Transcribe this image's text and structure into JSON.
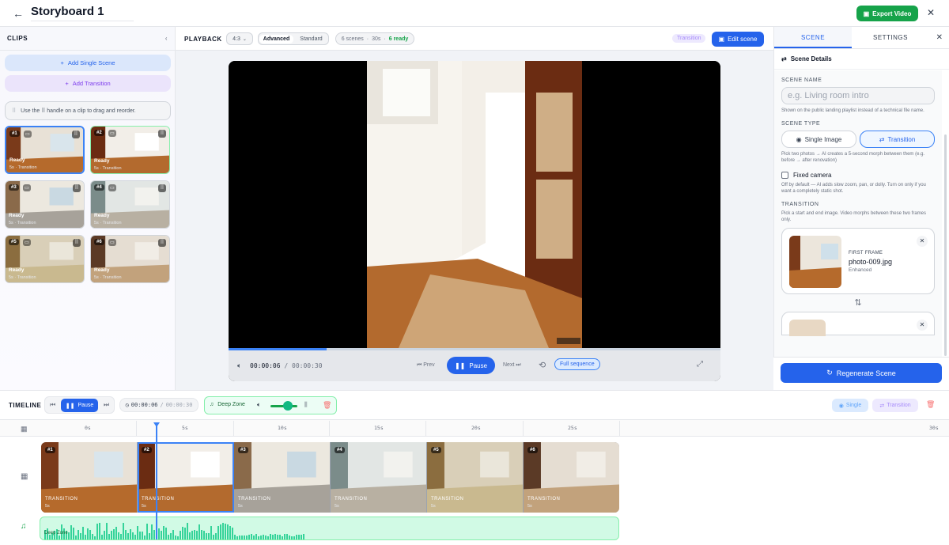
{
  "header": {
    "title": "Storyboard 1",
    "export_label": "Export Video"
  },
  "clips_panel": {
    "title": "CLIPS",
    "add_scene": "Add Single Scene",
    "add_transition": "Add Transition",
    "hint": "Use the ⠿ handle on a clip to drag and reorder.",
    "clips": [
      {
        "num": "#1",
        "status": "Ready",
        "meta": "5s · Transition"
      },
      {
        "num": "#2",
        "status": "Ready",
        "meta": "5s · Transition"
      },
      {
        "num": "#3",
        "status": "Ready",
        "meta": "5s · Transition"
      },
      {
        "num": "#4",
        "status": "Ready",
        "meta": "5s · Transition"
      },
      {
        "num": "#5",
        "status": "Ready",
        "meta": "5s · Transition"
      },
      {
        "num": "#6",
        "status": "Ready",
        "meta": "5s · Transition"
      }
    ]
  },
  "playback": {
    "title": "PLAYBACK",
    "ratio": "4:3",
    "mode_advanced": "Advanced",
    "mode_standard": "Standard",
    "stat_scenes": "6 scenes",
    "stat_duration": "30s",
    "stat_ready": "6 ready",
    "transition_tag": "Transition",
    "edit_label": "Edit scene",
    "current_time": "00:00:06",
    "total_time": "00:00:30",
    "time_sep": "/",
    "progress": 0.2,
    "prev": "Prev",
    "pause": "Pause",
    "next": "Next",
    "full_sequence": "Full sequence"
  },
  "right_panel": {
    "tab_scene": "SCENE",
    "tab_settings": "SETTINGS",
    "section_title": "Scene Details",
    "scene_name_label": "SCENE NAME",
    "scene_name_placeholder": "e.g. Living room intro",
    "scene_name_help": "Shown on the public landing playlist instead of a technical file name.",
    "scene_type_label": "SCENE TYPE",
    "type_single": "Single Image",
    "type_transition": "Transition",
    "type_help": "Pick two photos → AI creates a 5-second morph between them (e.g. before → after renovation)",
    "fixed_camera": "Fixed camera",
    "fixed_help": "Off by default — AI adds slow zoom, pan, or dolly. Turn on only if you want a completely static shot.",
    "transition_label": "TRANSITION",
    "transition_help": "Pick a start and end image. Video morphs between these two frames only.",
    "first_frame_label": "FIRST FRAME",
    "first_frame_file": "photo-009.jpg",
    "first_frame_status": "Enhanced",
    "regenerate": "Regenerate Scene"
  },
  "timeline": {
    "title": "TIMELINE",
    "pause": "Pause",
    "current_time": "00:00:06",
    "total_time": "00:00:30",
    "time_sep": "/",
    "music_name": "Deep Zone",
    "music_volume": 0.55,
    "single": "Single",
    "transition": "Transition",
    "ruler": [
      "0s",
      "5s",
      "10s",
      "15s",
      "20s",
      "25s",
      "30s"
    ],
    "clips": [
      {
        "num": "#1",
        "type": "TRANSITION",
        "dur": "5s"
      },
      {
        "num": "#2",
        "type": "TRANSITION",
        "dur": "5s"
      },
      {
        "num": "#3",
        "type": "TRANSITION",
        "dur": "5s"
      },
      {
        "num": "#4",
        "type": "TRANSITION",
        "dur": "5s"
      },
      {
        "num": "#5",
        "type": "TRANSITION",
        "dur": "5s"
      },
      {
        "num": "#6",
        "type": "TRANSITION",
        "dur": "5s"
      }
    ],
    "audio_label": "Deep Zone"
  },
  "colors": {
    "accent": "#2563eb",
    "success": "#16a34a",
    "transition": "#a78bfa"
  }
}
